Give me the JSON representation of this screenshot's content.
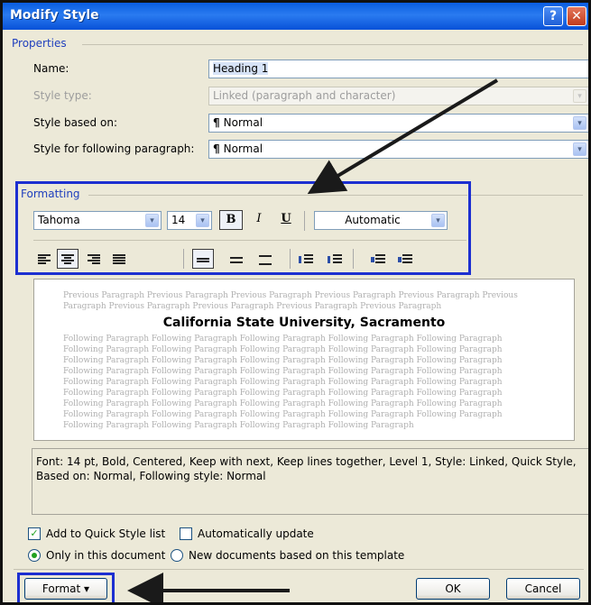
{
  "dialog": {
    "title": "Modify Style",
    "help_glyph": "?",
    "close_glyph": "✕"
  },
  "properties": {
    "section_label": "Properties",
    "name_label": "Name:",
    "name_value": "Heading 1",
    "style_type_label": "Style type:",
    "style_type_value": "Linked (paragraph and character)",
    "based_on_label": "Style based on:",
    "based_on_value": "Normal",
    "following_label": "Style for following paragraph:",
    "following_value": "Normal",
    "pilcrow": "¶"
  },
  "formatting": {
    "section_label": "Formatting",
    "font": "Tahoma",
    "size": "14",
    "bold": "B",
    "italic": "I",
    "underline": "U",
    "color": "Automatic"
  },
  "preview": {
    "previous_lines": [
      "Previous Paragraph Previous Paragraph Previous Paragraph Previous Paragraph Previous Paragraph Previous",
      "Paragraph Previous Paragraph Previous Paragraph Previous Paragraph Previous Paragraph"
    ],
    "heading": "California State University, Sacramento",
    "following_lines": [
      "Following Paragraph Following Paragraph Following Paragraph Following Paragraph Following Paragraph",
      "Following Paragraph Following Paragraph Following Paragraph Following Paragraph Following Paragraph",
      "Following Paragraph Following Paragraph Following Paragraph Following Paragraph Following Paragraph",
      "Following Paragraph Following Paragraph Following Paragraph Following Paragraph Following Paragraph",
      "Following Paragraph Following Paragraph Following Paragraph Following Paragraph Following Paragraph",
      "Following Paragraph Following Paragraph Following Paragraph Following Paragraph Following Paragraph",
      "Following Paragraph Following Paragraph Following Paragraph Following Paragraph Following Paragraph",
      "Following Paragraph Following Paragraph Following Paragraph Following Paragraph Following Paragraph",
      "Following Paragraph Following Paragraph Following Paragraph Following Paragraph"
    ]
  },
  "description": {
    "line1": "Font: 14 pt, Bold, Centered, Keep with next, Keep lines together, Level 1, Style: Linked, Quick Style,",
    "line2": "Based on: Normal, Following style: Normal"
  },
  "options": {
    "add_quick_style": "Add to Quick Style list",
    "auto_update": "Automatically update",
    "only_doc": "Only in this document",
    "new_docs": "New documents based on this template",
    "add_quick_style_checked": true,
    "auto_update_checked": false
  },
  "buttons": {
    "format": "Format",
    "format_arrow": "▾",
    "ok": "OK",
    "cancel": "Cancel"
  },
  "glyphs": {
    "check": "✓",
    "dropdown": "▾"
  },
  "colors": {
    "highlight_box": "#1c2fd1",
    "titlebar": "#0a5de0"
  }
}
